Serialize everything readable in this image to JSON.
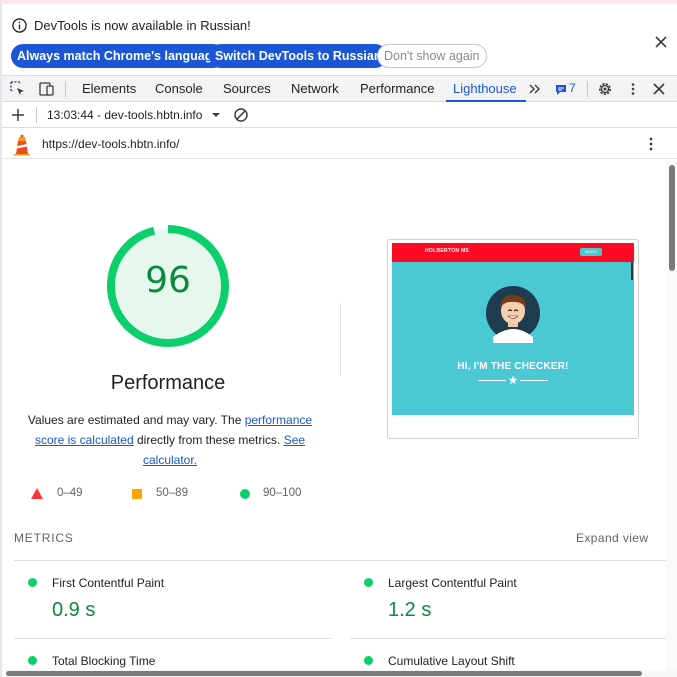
{
  "infobar": {
    "message": "DevTools is now available in Russian!",
    "btn_match": "Always match Chrome's language",
    "btn_switch": "Switch DevTools to Russian",
    "btn_dismiss": "Don't show again"
  },
  "tabs": [
    "Elements",
    "Console",
    "Sources",
    "Network",
    "Performance",
    "Lighthouse"
  ],
  "active_tab": "Lighthouse",
  "issues_count": "7",
  "toolbar": {
    "report_selector": "13:03:44 - dev-tools.hbtn.info"
  },
  "report": {
    "url": "https://dev-tools.hbtn.info/",
    "score": "96",
    "score_fraction": 0.96,
    "category": "Performance",
    "desc_pre": "Values are estimated and may vary. The ",
    "desc_link1": "performance score is calculated",
    "desc_mid": " directly from these metrics. ",
    "desc_link2": "See calculator.",
    "legend": [
      "0–49",
      "50–89",
      "90–100"
    ],
    "screenshot": {
      "brand": "HOLBERTON MS",
      "nav_button": "VIDEO",
      "headline": "HI, I'M THE CHECKER!"
    },
    "metrics_header": "METRICS",
    "expand_view": "Expand view",
    "metrics": [
      {
        "name": "First Contentful Paint",
        "value": "0.9 s"
      },
      {
        "name": "Largest Contentful Paint",
        "value": "1.2 s"
      },
      {
        "name": "Total Blocking Time",
        "value": ""
      },
      {
        "name": "Cumulative Layout Shift",
        "value": ""
      }
    ]
  },
  "colors": {
    "accent": "#1a56d6",
    "pass": "#0cce6b",
    "pass_text": "#0b8a3e",
    "average": "#ffa400",
    "fail": "#ff3333",
    "hero": "#4ac8d3",
    "nav": "#ff0a23"
  }
}
